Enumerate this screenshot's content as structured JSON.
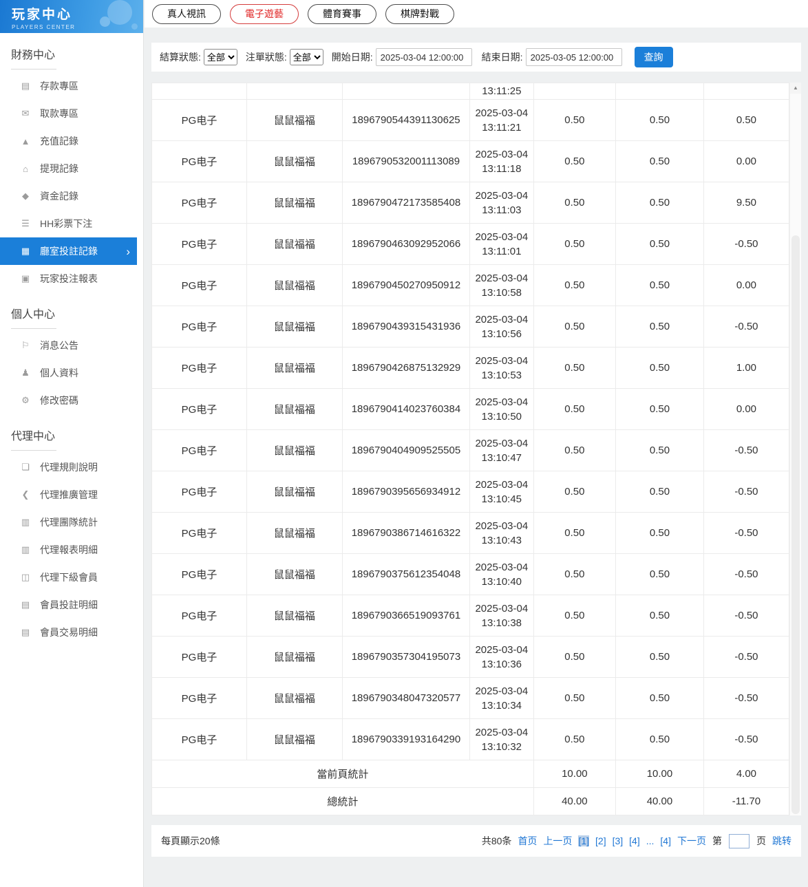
{
  "app": {
    "title": "玩家中心",
    "subtitle": "PLAYERS CENTER"
  },
  "sidebar": {
    "sections": [
      {
        "title": "財務中心",
        "items": [
          {
            "label": "存款專區",
            "icon": "deposit-icon",
            "active": false
          },
          {
            "label": "取款專區",
            "icon": "withdraw-icon",
            "active": false
          },
          {
            "label": "充值記錄",
            "icon": "recharge-icon",
            "active": false
          },
          {
            "label": "提現記錄",
            "icon": "cashout-icon",
            "active": false
          },
          {
            "label": "資金記錄",
            "icon": "funds-icon",
            "active": false
          },
          {
            "label": "HH彩票下注",
            "icon": "lottery-icon",
            "active": false
          },
          {
            "label": "廳室投註記錄",
            "icon": "room-bets-icon",
            "active": true
          },
          {
            "label": "玩家投注報表",
            "icon": "report-icon",
            "active": false
          }
        ]
      },
      {
        "title": "個人中心",
        "items": [
          {
            "label": "消息公告",
            "icon": "bell-icon",
            "active": false
          },
          {
            "label": "個人資料",
            "icon": "user-icon",
            "active": false
          },
          {
            "label": "修改密碼",
            "icon": "gear-icon",
            "active": false
          }
        ]
      },
      {
        "title": "代理中心",
        "items": [
          {
            "label": "代理規則說明",
            "icon": "doc-icon",
            "active": false
          },
          {
            "label": "代理推廣管理",
            "icon": "share-icon",
            "active": false
          },
          {
            "label": "代理團隊統計",
            "icon": "chart-icon",
            "active": false
          },
          {
            "label": "代理報表明細",
            "icon": "chart-icon",
            "active": false
          },
          {
            "label": "代理下級會員",
            "icon": "users-icon",
            "active": false
          },
          {
            "label": "會員投註明細",
            "icon": "list-icon",
            "active": false
          },
          {
            "label": "會員交易明細",
            "icon": "list-icon",
            "active": false
          }
        ]
      }
    ]
  },
  "tabs": [
    {
      "label": "真人視訊",
      "active": false
    },
    {
      "label": "電子遊藝",
      "active": true
    },
    {
      "label": "體育賽事",
      "active": false
    },
    {
      "label": "棋牌對戰",
      "active": false
    }
  ],
  "filters": {
    "settle_status_label": "結算狀態:",
    "settle_status_value": "全部",
    "order_status_label": "注單狀態:",
    "order_status_value": "全部",
    "start_date_label": "開始日期:",
    "start_date_value": "2025-03-04 12:00:00",
    "end_date_label": "結束日期:",
    "end_date_value": "2025-03-05 12:00:00",
    "search_label": "查詢"
  },
  "table": {
    "partial_row": {
      "time": "13:11:25"
    },
    "rows": [
      {
        "provider": "PG电子",
        "game": "鼠鼠福福",
        "order": "1896790544391130625",
        "date": "2025-03-04",
        "time": "13:11:21",
        "bet": "0.50",
        "valid": "0.50",
        "result": "0.50"
      },
      {
        "provider": "PG电子",
        "game": "鼠鼠福福",
        "order": "1896790532001113089",
        "date": "2025-03-04",
        "time": "13:11:18",
        "bet": "0.50",
        "valid": "0.50",
        "result": "0.00"
      },
      {
        "provider": "PG电子",
        "game": "鼠鼠福福",
        "order": "1896790472173585408",
        "date": "2025-03-04",
        "time": "13:11:03",
        "bet": "0.50",
        "valid": "0.50",
        "result": "9.50"
      },
      {
        "provider": "PG电子",
        "game": "鼠鼠福福",
        "order": "1896790463092952066",
        "date": "2025-03-04",
        "time": "13:11:01",
        "bet": "0.50",
        "valid": "0.50",
        "result": "-0.50"
      },
      {
        "provider": "PG电子",
        "game": "鼠鼠福福",
        "order": "1896790450270950912",
        "date": "2025-03-04",
        "time": "13:10:58",
        "bet": "0.50",
        "valid": "0.50",
        "result": "0.00"
      },
      {
        "provider": "PG电子",
        "game": "鼠鼠福福",
        "order": "1896790439315431936",
        "date": "2025-03-04",
        "time": "13:10:56",
        "bet": "0.50",
        "valid": "0.50",
        "result": "-0.50"
      },
      {
        "provider": "PG电子",
        "game": "鼠鼠福福",
        "order": "1896790426875132929",
        "date": "2025-03-04",
        "time": "13:10:53",
        "bet": "0.50",
        "valid": "0.50",
        "result": "1.00"
      },
      {
        "provider": "PG电子",
        "game": "鼠鼠福福",
        "order": "1896790414023760384",
        "date": "2025-03-04",
        "time": "13:10:50",
        "bet": "0.50",
        "valid": "0.50",
        "result": "0.00"
      },
      {
        "provider": "PG电子",
        "game": "鼠鼠福福",
        "order": "1896790404909525505",
        "date": "2025-03-04",
        "time": "13:10:47",
        "bet": "0.50",
        "valid": "0.50",
        "result": "-0.50"
      },
      {
        "provider": "PG电子",
        "game": "鼠鼠福福",
        "order": "1896790395656934912",
        "date": "2025-03-04",
        "time": "13:10:45",
        "bet": "0.50",
        "valid": "0.50",
        "result": "-0.50"
      },
      {
        "provider": "PG电子",
        "game": "鼠鼠福福",
        "order": "1896790386714616322",
        "date": "2025-03-04",
        "time": "13:10:43",
        "bet": "0.50",
        "valid": "0.50",
        "result": "-0.50"
      },
      {
        "provider": "PG电子",
        "game": "鼠鼠福福",
        "order": "1896790375612354048",
        "date": "2025-03-04",
        "time": "13:10:40",
        "bet": "0.50",
        "valid": "0.50",
        "result": "-0.50"
      },
      {
        "provider": "PG电子",
        "game": "鼠鼠福福",
        "order": "1896790366519093761",
        "date": "2025-03-04",
        "time": "13:10:38",
        "bet": "0.50",
        "valid": "0.50",
        "result": "-0.50"
      },
      {
        "provider": "PG电子",
        "game": "鼠鼠福福",
        "order": "1896790357304195073",
        "date": "2025-03-04",
        "time": "13:10:36",
        "bet": "0.50",
        "valid": "0.50",
        "result": "-0.50"
      },
      {
        "provider": "PG电子",
        "game": "鼠鼠福福",
        "order": "1896790348047320577",
        "date": "2025-03-04",
        "time": "13:10:34",
        "bet": "0.50",
        "valid": "0.50",
        "result": "-0.50"
      },
      {
        "provider": "PG电子",
        "game": "鼠鼠福福",
        "order": "1896790339193164290",
        "date": "2025-03-04",
        "time": "13:10:32",
        "bet": "0.50",
        "valid": "0.50",
        "result": "-0.50"
      }
    ],
    "page_summary": {
      "label": "當前頁統計",
      "bet": "10.00",
      "valid": "10.00",
      "result": "4.00"
    },
    "total_summary": {
      "label": "總統計",
      "bet": "40.00",
      "valid": "40.00",
      "result": "-11.70"
    }
  },
  "pagination": {
    "per_page": "每頁顯示20條",
    "total": "共80条",
    "first": "首页",
    "prev": "上一页",
    "pages": [
      {
        "label": "[1]",
        "current": true
      },
      {
        "label": "[2]",
        "current": false
      },
      {
        "label": "[3]",
        "current": false
      },
      {
        "label": "[4]",
        "current": false
      },
      {
        "label": "...",
        "ellipsis": true
      },
      {
        "label": "[4]",
        "current": false
      }
    ],
    "next": "下一页",
    "jump_prefix": "第",
    "jump_suffix": "页",
    "jump_value": "",
    "jump_button": "跳转"
  },
  "colors": {
    "accent": "#1b7fd9",
    "tab_active_red": "#e02626"
  }
}
